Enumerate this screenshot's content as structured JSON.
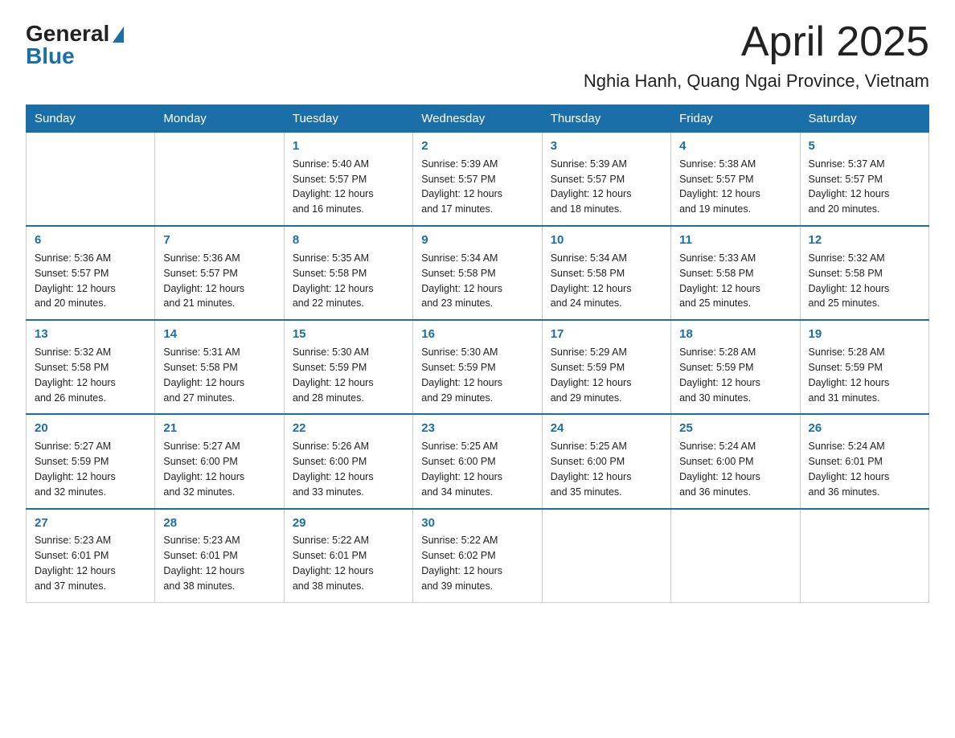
{
  "header": {
    "logo_general": "General",
    "logo_blue": "Blue",
    "month_title": "April 2025",
    "location": "Nghia Hanh, Quang Ngai Province, Vietnam"
  },
  "days_of_week": [
    "Sunday",
    "Monday",
    "Tuesday",
    "Wednesday",
    "Thursday",
    "Friday",
    "Saturday"
  ],
  "weeks": [
    [
      {
        "day": "",
        "info": ""
      },
      {
        "day": "",
        "info": ""
      },
      {
        "day": "1",
        "info": "Sunrise: 5:40 AM\nSunset: 5:57 PM\nDaylight: 12 hours\nand 16 minutes."
      },
      {
        "day": "2",
        "info": "Sunrise: 5:39 AM\nSunset: 5:57 PM\nDaylight: 12 hours\nand 17 minutes."
      },
      {
        "day": "3",
        "info": "Sunrise: 5:39 AM\nSunset: 5:57 PM\nDaylight: 12 hours\nand 18 minutes."
      },
      {
        "day": "4",
        "info": "Sunrise: 5:38 AM\nSunset: 5:57 PM\nDaylight: 12 hours\nand 19 minutes."
      },
      {
        "day": "5",
        "info": "Sunrise: 5:37 AM\nSunset: 5:57 PM\nDaylight: 12 hours\nand 20 minutes."
      }
    ],
    [
      {
        "day": "6",
        "info": "Sunrise: 5:36 AM\nSunset: 5:57 PM\nDaylight: 12 hours\nand 20 minutes."
      },
      {
        "day": "7",
        "info": "Sunrise: 5:36 AM\nSunset: 5:57 PM\nDaylight: 12 hours\nand 21 minutes."
      },
      {
        "day": "8",
        "info": "Sunrise: 5:35 AM\nSunset: 5:58 PM\nDaylight: 12 hours\nand 22 minutes."
      },
      {
        "day": "9",
        "info": "Sunrise: 5:34 AM\nSunset: 5:58 PM\nDaylight: 12 hours\nand 23 minutes."
      },
      {
        "day": "10",
        "info": "Sunrise: 5:34 AM\nSunset: 5:58 PM\nDaylight: 12 hours\nand 24 minutes."
      },
      {
        "day": "11",
        "info": "Sunrise: 5:33 AM\nSunset: 5:58 PM\nDaylight: 12 hours\nand 25 minutes."
      },
      {
        "day": "12",
        "info": "Sunrise: 5:32 AM\nSunset: 5:58 PM\nDaylight: 12 hours\nand 25 minutes."
      }
    ],
    [
      {
        "day": "13",
        "info": "Sunrise: 5:32 AM\nSunset: 5:58 PM\nDaylight: 12 hours\nand 26 minutes."
      },
      {
        "day": "14",
        "info": "Sunrise: 5:31 AM\nSunset: 5:58 PM\nDaylight: 12 hours\nand 27 minutes."
      },
      {
        "day": "15",
        "info": "Sunrise: 5:30 AM\nSunset: 5:59 PM\nDaylight: 12 hours\nand 28 minutes."
      },
      {
        "day": "16",
        "info": "Sunrise: 5:30 AM\nSunset: 5:59 PM\nDaylight: 12 hours\nand 29 minutes."
      },
      {
        "day": "17",
        "info": "Sunrise: 5:29 AM\nSunset: 5:59 PM\nDaylight: 12 hours\nand 29 minutes."
      },
      {
        "day": "18",
        "info": "Sunrise: 5:28 AM\nSunset: 5:59 PM\nDaylight: 12 hours\nand 30 minutes."
      },
      {
        "day": "19",
        "info": "Sunrise: 5:28 AM\nSunset: 5:59 PM\nDaylight: 12 hours\nand 31 minutes."
      }
    ],
    [
      {
        "day": "20",
        "info": "Sunrise: 5:27 AM\nSunset: 5:59 PM\nDaylight: 12 hours\nand 32 minutes."
      },
      {
        "day": "21",
        "info": "Sunrise: 5:27 AM\nSunset: 6:00 PM\nDaylight: 12 hours\nand 32 minutes."
      },
      {
        "day": "22",
        "info": "Sunrise: 5:26 AM\nSunset: 6:00 PM\nDaylight: 12 hours\nand 33 minutes."
      },
      {
        "day": "23",
        "info": "Sunrise: 5:25 AM\nSunset: 6:00 PM\nDaylight: 12 hours\nand 34 minutes."
      },
      {
        "day": "24",
        "info": "Sunrise: 5:25 AM\nSunset: 6:00 PM\nDaylight: 12 hours\nand 35 minutes."
      },
      {
        "day": "25",
        "info": "Sunrise: 5:24 AM\nSunset: 6:00 PM\nDaylight: 12 hours\nand 36 minutes."
      },
      {
        "day": "26",
        "info": "Sunrise: 5:24 AM\nSunset: 6:01 PM\nDaylight: 12 hours\nand 36 minutes."
      }
    ],
    [
      {
        "day": "27",
        "info": "Sunrise: 5:23 AM\nSunset: 6:01 PM\nDaylight: 12 hours\nand 37 minutes."
      },
      {
        "day": "28",
        "info": "Sunrise: 5:23 AM\nSunset: 6:01 PM\nDaylight: 12 hours\nand 38 minutes."
      },
      {
        "day": "29",
        "info": "Sunrise: 5:22 AM\nSunset: 6:01 PM\nDaylight: 12 hours\nand 38 minutes."
      },
      {
        "day": "30",
        "info": "Sunrise: 5:22 AM\nSunset: 6:02 PM\nDaylight: 12 hours\nand 39 minutes."
      },
      {
        "day": "",
        "info": ""
      },
      {
        "day": "",
        "info": ""
      },
      {
        "day": "",
        "info": ""
      }
    ]
  ]
}
